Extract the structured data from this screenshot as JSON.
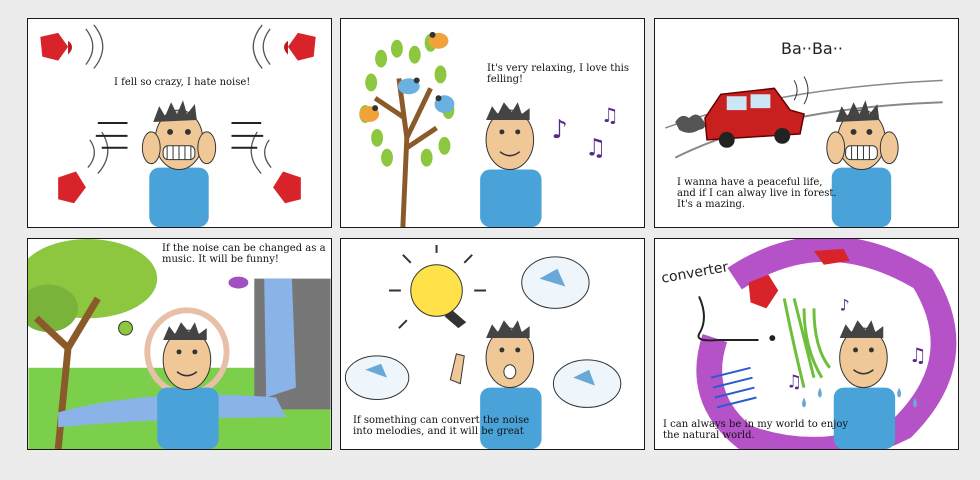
{
  "panels": [
    {
      "id": 1,
      "caption": "I fell so crazy, I hate noise!"
    },
    {
      "id": 2,
      "caption": "It's very relaxing, I love this felling!"
    },
    {
      "id": 3,
      "caption": "I wanna have a peaceful life, and if I can alway live in forest. It's a mazing.",
      "sound_effect": "Ba··Ba··"
    },
    {
      "id": 4,
      "caption": "If the noise can be changed as a music. It will be funny!"
    },
    {
      "id": 5,
      "caption": "If something can convert the noise into melodies, and it will be great"
    },
    {
      "id": 6,
      "caption": "I can always be in my world to enjoy the natural world.",
      "label": "converter"
    }
  ],
  "colors": {
    "shirt": "#4aa3d8",
    "skin": "#f0c898",
    "hair": "#444444",
    "speaker": "#d8232a",
    "leaves": "#8dc63f",
    "car": "#c8201f",
    "bulb": "#ffe14a",
    "purple_ring": "#b552c8",
    "notes": "#5a2a8a"
  }
}
